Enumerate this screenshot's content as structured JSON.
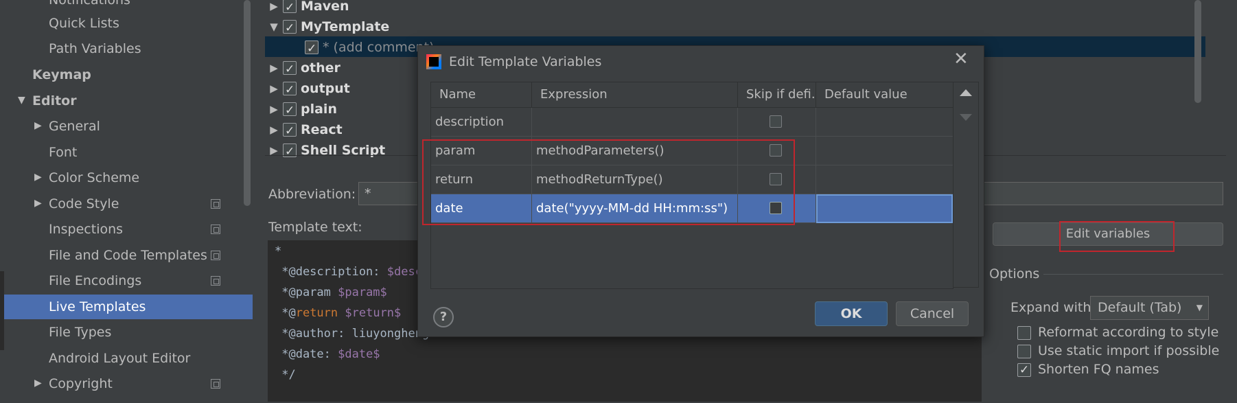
{
  "sidebar": {
    "items": [
      {
        "label": "Notifications"
      },
      {
        "label": "Quick Lists"
      },
      {
        "label": "Path Variables"
      },
      {
        "label": "Keymap"
      },
      {
        "label": "Editor"
      },
      {
        "label": "General"
      },
      {
        "label": "Font"
      },
      {
        "label": "Color Scheme"
      },
      {
        "label": "Code Style"
      },
      {
        "label": "Inspections"
      },
      {
        "label": "File and Code Templates"
      },
      {
        "label": "File Encodings"
      },
      {
        "label": "Live Templates"
      },
      {
        "label": "File Types"
      },
      {
        "label": "Android Layout Editor"
      },
      {
        "label": "Copyright"
      }
    ]
  },
  "tree": {
    "groups": [
      {
        "label": "Maven"
      },
      {
        "label": "MyTemplate"
      },
      {
        "label": "* (add comment)"
      },
      {
        "label": "other"
      },
      {
        "label": "output"
      },
      {
        "label": "plain"
      },
      {
        "label": "React"
      },
      {
        "label": "Shell Script"
      }
    ]
  },
  "abbreviation": {
    "label": "Abbreviation:",
    "value": "*"
  },
  "template_text": {
    "label": "Template text:",
    "lines": [
      "*",
      " *@description: ",
      "$descr",
      " *@param ",
      "$param$",
      " *@",
      "return",
      " ",
      "$return$",
      " *@author: liuyongheng",
      " *@date: ",
      "$date$",
      " */"
    ]
  },
  "edit_variables_label": "Edit variables",
  "options": {
    "title": "Options",
    "expand_with_label": "Expand with",
    "expand_with_value": "Default (Tab)",
    "reformat_label": "Reformat according to style",
    "static_import_label": "Use static import if possible",
    "shorten_fq_label": "Shorten FQ names"
  },
  "dialog": {
    "title": "Edit Template Variables",
    "columns": [
      "Name",
      "Expression",
      "Skip if defi...",
      "Default value"
    ],
    "rows": [
      {
        "name": "description",
        "expression": "",
        "default": ""
      },
      {
        "name": "param",
        "expression": "methodParameters()",
        "default": ""
      },
      {
        "name": "return",
        "expression": "methodReturnType()",
        "default": ""
      },
      {
        "name": "date",
        "expression": "date(\"yyyy-MM-dd HH:mm:ss\")",
        "default": ""
      }
    ],
    "help_label": "?",
    "ok_label": "OK",
    "cancel_label": "Cancel"
  },
  "colors": {
    "selection": "#4b6eaf",
    "highlight_box": "#c0262d",
    "background": "#3c3f41"
  }
}
